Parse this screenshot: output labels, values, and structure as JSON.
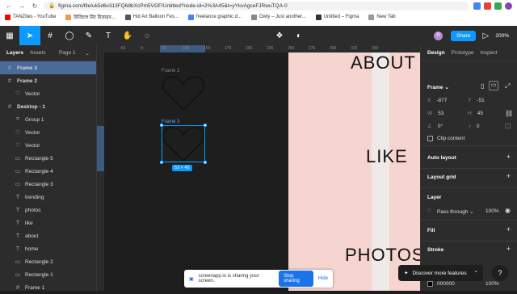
{
  "browser": {
    "url": "figma.com/file/uk5d6v313FQ68bXcPm5VGF/Untitled?node-id=2%3A45&t=yYkvAgceFJRwuTQA-0",
    "bookmarks": [
      {
        "label": "TANZites - YouTube",
        "color": "#ff0000"
      },
      {
        "label": "डिजिटल प्रिंट डिज़ाइन...",
        "color": "#f2994a"
      },
      {
        "label": "Hot Air Balloon Fes...",
        "color": "#555555"
      },
      {
        "label": "freelance graphic d...",
        "color": "#4285f4"
      },
      {
        "label": "Owly – Just another...",
        "color": "#888888"
      },
      {
        "label": "Untitled – Figma",
        "color": "#333333"
      },
      {
        "label": "New Tab",
        "color": "#999999"
      }
    ]
  },
  "toolbar": {
    "avatar_letter": "R",
    "share_label": "Share",
    "play_icon": "▷",
    "zoom": "200%"
  },
  "layers_panel": {
    "tab_layers": "Layers",
    "tab_assets": "Assets",
    "page": "Page 1",
    "items": [
      {
        "icon": "#",
        "label": "Frame 3",
        "indent": 0,
        "selected": true
      },
      {
        "icon": "#",
        "label": "Frame 2",
        "indent": 0,
        "selected": false
      },
      {
        "icon": "♡",
        "label": "Vector",
        "indent": 1,
        "selected": false
      },
      {
        "icon": "#",
        "label": "Desktop - 1",
        "indent": 0,
        "selected": false
      },
      {
        "icon": "⌗",
        "label": "Group 1",
        "indent": 1,
        "selected": false
      },
      {
        "icon": "♡",
        "label": "Vector",
        "indent": 1,
        "selected": false
      },
      {
        "icon": "♡",
        "label": "Vector",
        "indent": 1,
        "selected": false
      },
      {
        "icon": "▭",
        "label": "Rectangle 5",
        "indent": 1,
        "selected": false
      },
      {
        "icon": "▭",
        "label": "Rectangle 4",
        "indent": 1,
        "selected": false
      },
      {
        "icon": "▭",
        "label": "Rectangle 3",
        "indent": 1,
        "selected": false
      },
      {
        "icon": "T",
        "label": "trending",
        "indent": 1,
        "selected": false
      },
      {
        "icon": "T",
        "label": "photos",
        "indent": 1,
        "selected": false
      },
      {
        "icon": "T",
        "label": "like",
        "indent": 1,
        "selected": false
      },
      {
        "icon": "T",
        "label": "about",
        "indent": 1,
        "selected": false
      },
      {
        "icon": "T",
        "label": "home",
        "indent": 1,
        "selected": false
      },
      {
        "icon": "▭",
        "label": "Rectangle 2",
        "indent": 1,
        "selected": false
      },
      {
        "icon": "▭",
        "label": "Rectangle 1",
        "indent": 1,
        "selected": false
      },
      {
        "icon": "#",
        "label": "Frame 1",
        "indent": 1,
        "selected": false
      }
    ]
  },
  "canvas": {
    "ruler_ticks": [
      "-50",
      "0",
      "53",
      "100",
      "150",
      "176",
      "200",
      "226",
      "250",
      "276",
      "300",
      "326",
      "350"
    ],
    "frame2_label": "Frame 2",
    "frame3_label": "Frame 3",
    "size_badge": "53 × 45",
    "desktop_texts": {
      "about": "ABOUT",
      "like": "LIKE",
      "photos": "PHOTOS"
    },
    "desktop_bg": "#f6d4cf"
  },
  "design_panel": {
    "tabs": [
      "Design",
      "Prototype",
      "Inspect"
    ],
    "frame_label": "Frame",
    "x_label": "X",
    "x_value": "-877",
    "y_label": "Y",
    "y_value": "-51",
    "w_label": "W",
    "w_value": "53",
    "h_label": "H",
    "h_value": "45",
    "rotation": "0°",
    "radius": "0",
    "clip_content": "Clip content",
    "auto_layout": "Auto layout",
    "layout_grid": "Layout grid",
    "layer": "Layer",
    "pass_through": "Pass through",
    "opacity": "100%",
    "fill": "Fill",
    "stroke": "Stroke",
    "fill_hex": "000000",
    "fill_opacity": "100%"
  },
  "screen_share": {
    "message": "screenapp.io is sharing your screen.",
    "stop": "Stop sharing",
    "hide": "Hide"
  },
  "discover": {
    "label": "Discover more features"
  },
  "help": {
    "label": "?"
  }
}
